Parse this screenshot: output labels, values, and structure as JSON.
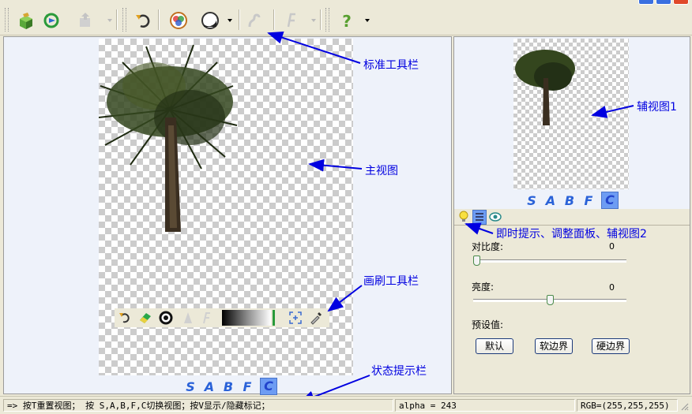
{
  "toolbar": {
    "icons": [
      "open-3d-icon",
      "refresh-view-icon",
      "export-icon",
      "undo-icon",
      "color-wheel-icon",
      "mask-icon",
      "curve-icon",
      "brush-f-icon",
      "help-icon"
    ]
  },
  "main_view": {
    "sabfc": [
      "S",
      "A",
      "B",
      "F",
      "C"
    ],
    "active_mode": "C"
  },
  "brush_toolbar": {
    "icons": [
      "undo-icon",
      "eraser-icon",
      "mask-circle-icon",
      "cone-icon",
      "f-icon",
      "fit-view-icon",
      "eyedropper-icon"
    ]
  },
  "aux_view": {
    "sabfc": [
      "S",
      "A",
      "B",
      "F",
      "C"
    ],
    "active_mode": "C"
  },
  "annotations": {
    "standard_toolbar": "标准工具栏",
    "main_view": "主视图",
    "brush_toolbar": "画刷工具栏",
    "status_bar": "状态提示栏",
    "aux_view1": "辅视图1",
    "panels": "即时提示、调整面板、辅视图2"
  },
  "adjust_panel": {
    "contrast_label": "对比度:",
    "contrast_value": "0",
    "contrast_level": 0,
    "brightness_label": "亮度:",
    "brightness_value": "0",
    "brightness_level": 0.5,
    "preset_label": "预设值:",
    "buttons": [
      "默认",
      "软边界",
      "硬边界"
    ]
  },
  "status_bar": {
    "hint": "=> 按T重置视图； 按 S,A,B,F,C切换视图；按V显示/隐藏标记；",
    "alpha": "alpha = 243",
    "rgb": "RGB=(255,255,255)"
  },
  "colors": {
    "accent": "#2a62d8",
    "annotation": "#0000e0"
  }
}
